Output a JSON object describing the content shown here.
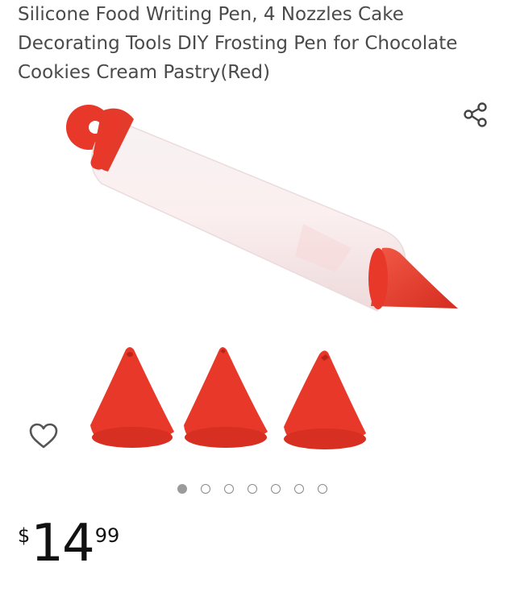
{
  "product": {
    "title": "Silicone Food Writing Pen, 4 Nozzles Cake Decorating Tools DIY Frosting Pen for Chocolate Cookies Cream Pastry(Red)",
    "image_alt": "Red silicone food writing pen with three nozzles",
    "colors": {
      "accent_red": "#e8382a",
      "body_white": "#f4eeee"
    }
  },
  "actions": {
    "share_icon": "share-icon",
    "wishlist_icon": "heart-outline-icon"
  },
  "carousel": {
    "total": 7,
    "active_index": 0
  },
  "price": {
    "symbol": "$",
    "whole": "14",
    "fraction": "99"
  }
}
